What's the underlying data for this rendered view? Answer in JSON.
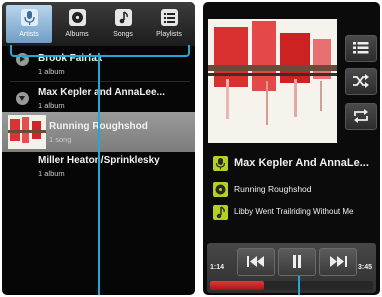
{
  "tabs": [
    {
      "label": "Artists",
      "icon": "microphone-icon",
      "active": true
    },
    {
      "label": "Albums",
      "icon": "album-icon",
      "active": false
    },
    {
      "label": "Songs",
      "icon": "music-note-icon",
      "active": false
    },
    {
      "label": "Playlists",
      "icon": "playlist-icon",
      "active": false
    }
  ],
  "library": {
    "rows": [
      {
        "title": "Brook Fairfax",
        "sub": "1 album"
      },
      {
        "title": "Max Kepler and AnnaLee...",
        "sub": "1 album"
      },
      {
        "title": "Running Roughshod",
        "sub": "1 song"
      },
      {
        "title": "Miller Heaton/Sprinklesky",
        "sub": "1 album"
      }
    ]
  },
  "now_playing": {
    "artist": "Max Kepler And AnnaLe...",
    "album": "Running Roughshod",
    "track": "Libby Went Trailriding Without  Me",
    "elapsed": "1:14",
    "duration": "3:45",
    "progress_percent": 33
  },
  "side_buttons": [
    {
      "icon": "queue-list-icon"
    },
    {
      "icon": "shuffle-icon"
    },
    {
      "icon": "repeat-icon"
    }
  ],
  "colors": {
    "accent": "#25a6d9",
    "active_tab": "#7aa8d2",
    "info_icon": "#b7cf1d",
    "progress": "#d02828"
  }
}
